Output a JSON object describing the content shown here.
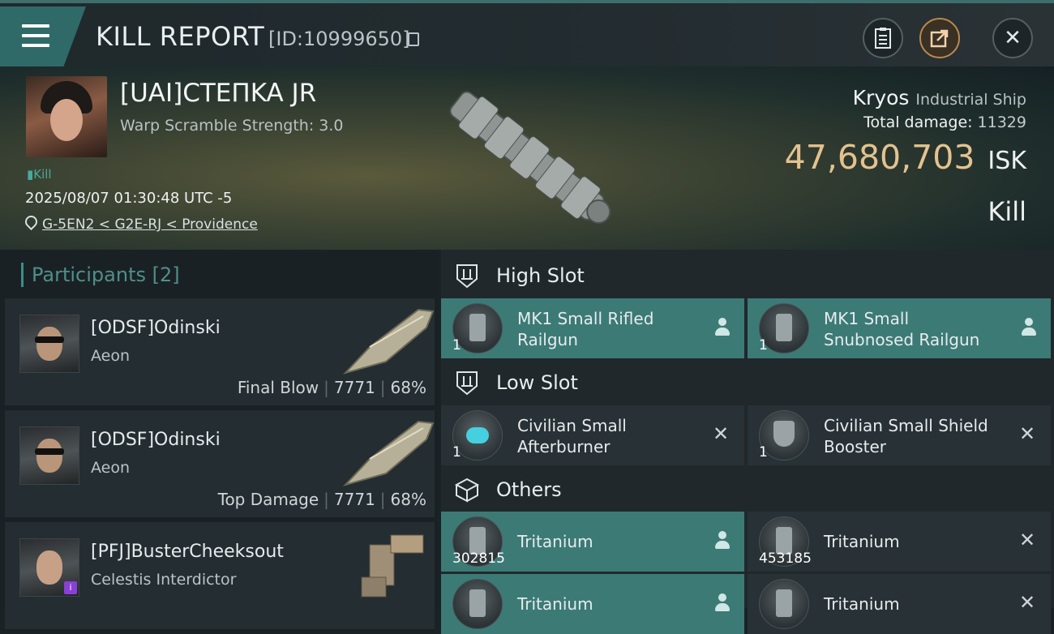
{
  "titlebar": {
    "title": "KILL REPORT",
    "kill_id": "[ID:10999650]",
    "close_symbol": "✕",
    "icons": [
      "menu-icon",
      "copy-icon",
      "clipboard-icon",
      "share-icon",
      "close-icon"
    ]
  },
  "victim": {
    "name": "[UAI]CTEПKA JR",
    "warp_scramble": "Warp Scramble Strength: 3.0",
    "tag": "Kill",
    "time": "2025/08/07 01:30:48 UTC -5",
    "location": "G-5EN2 < G2E-RJ < Providence"
  },
  "ship": {
    "name": "Kryos",
    "class": "Industrial Ship",
    "total_damage_label": "Total damage:",
    "total_damage": "11329",
    "isk_value": "47,680,703",
    "isk_unit": "ISK",
    "result": "Kill"
  },
  "participants": {
    "header": "Participants",
    "count": "[2]",
    "rows": [
      {
        "name": "[ODSF]Odinski",
        "ship": "Aeon",
        "role": "Final Blow",
        "damage": "7771",
        "percent": "68%"
      },
      {
        "name": "[ODSF]Odinski",
        "ship": "Aeon",
        "role": "Top Damage",
        "damage": "7771",
        "percent": "68%"
      },
      {
        "name": "[PFJ]BusterCheeksout",
        "ship": "Celestis Interdictor",
        "role": "",
        "damage": "",
        "percent": ""
      }
    ]
  },
  "slots": {
    "high": {
      "title": "High Slot",
      "items": [
        {
          "name": "MK1 Small Rifled Railgun",
          "qty": "1"
        },
        {
          "name": "MK1 Small Snubnosed Railgun",
          "qty": "1"
        }
      ]
    },
    "low": {
      "title": "Low Slot",
      "items": [
        {
          "name": "Civilian Small Afterburner",
          "qty": "1"
        },
        {
          "name": "Civilian Small Shield Booster",
          "qty": "1"
        }
      ]
    },
    "others": {
      "title": "Others",
      "items": [
        {
          "name": "Tritanium",
          "qty": "302815"
        },
        {
          "name": "Tritanium",
          "qty": "453185"
        },
        {
          "name": "Tritanium",
          "qty": ""
        },
        {
          "name": "Tritanium",
          "qty": ""
        }
      ]
    },
    "x_symbol": "✕"
  }
}
